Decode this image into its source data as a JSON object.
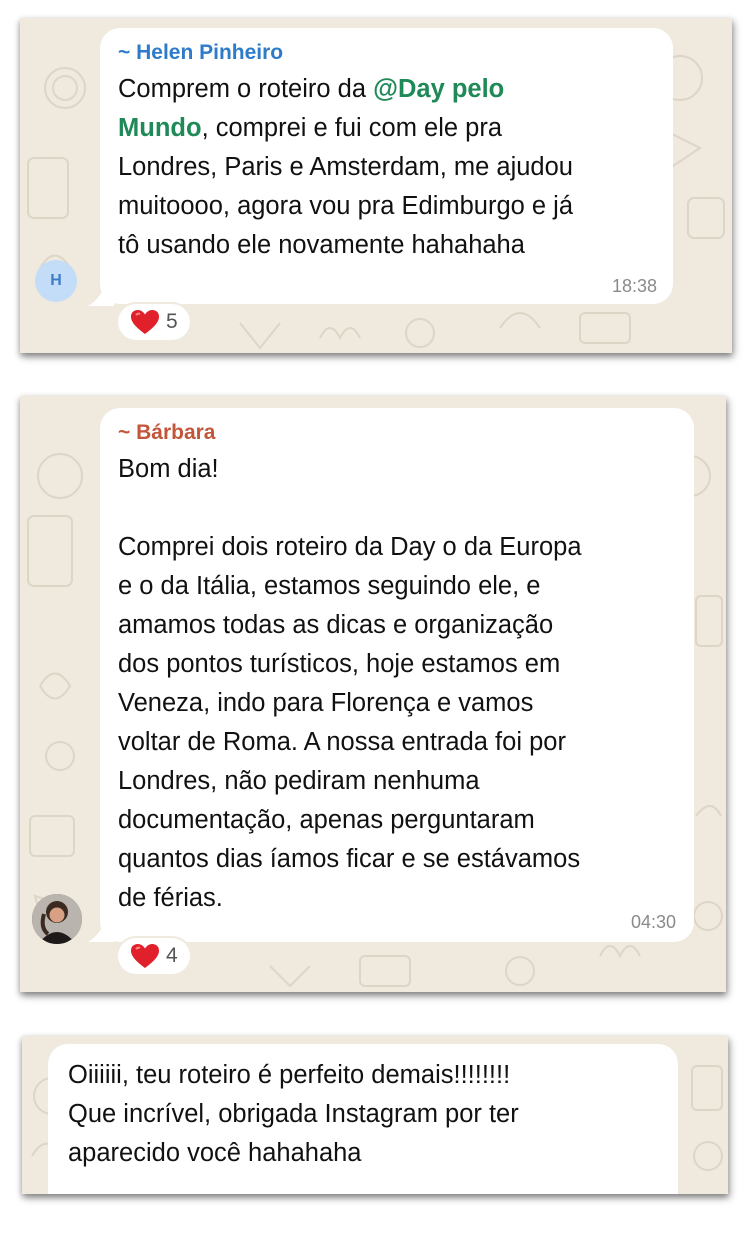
{
  "colors": {
    "chat_background": "#efe9de",
    "sender_helen": "#2e7bc9",
    "sender_barbara": "#c2553a",
    "mention": "#1f8a58",
    "heart": "#e0202a",
    "timestamp": "#8a8a8a"
  },
  "messages": [
    {
      "sender": "~ Helen Pinheiro",
      "mention": "@Day pelo",
      "mention_cont": "Mundo",
      "text_before": "Comprem o roteiro da ",
      "text_after": ", comprei e fui com ele pra\nLondres, Paris e Amsterdam, me ajudou\nmuitoooo, agora vou pra Edimburgo e já\ntô usando ele novamente hahahaha",
      "time": "18:38",
      "avatar_letter": "H",
      "reaction_icon": "heart-icon",
      "reaction_count": "5"
    },
    {
      "sender": "~ Bárbara",
      "text": "Bom dia!\n\nComprei dois roteiro da Day o da Europa\ne o da Itália, estamos seguindo ele, e\namamos todas as dicas e organização\ndos pontos turísticos, hoje estamos em\nVeneza, indo para Florença e vamos\nvoltar de Roma. A nossa entrada foi por\nLondres, não pediram nenhuma\ndocumentação, apenas perguntaram\nquantos dias íamos ficar e se estávamos\nde férias.",
      "time": "04:30",
      "avatar_icon": "profile-photo",
      "reaction_icon": "heart-icon",
      "reaction_count": "4"
    },
    {
      "text": "Oiiiiii, teu roteiro é perfeito demais!!!!!!!!\nQue incrível, obrigada Instagram por ter\naparecido você hahahaha"
    }
  ]
}
